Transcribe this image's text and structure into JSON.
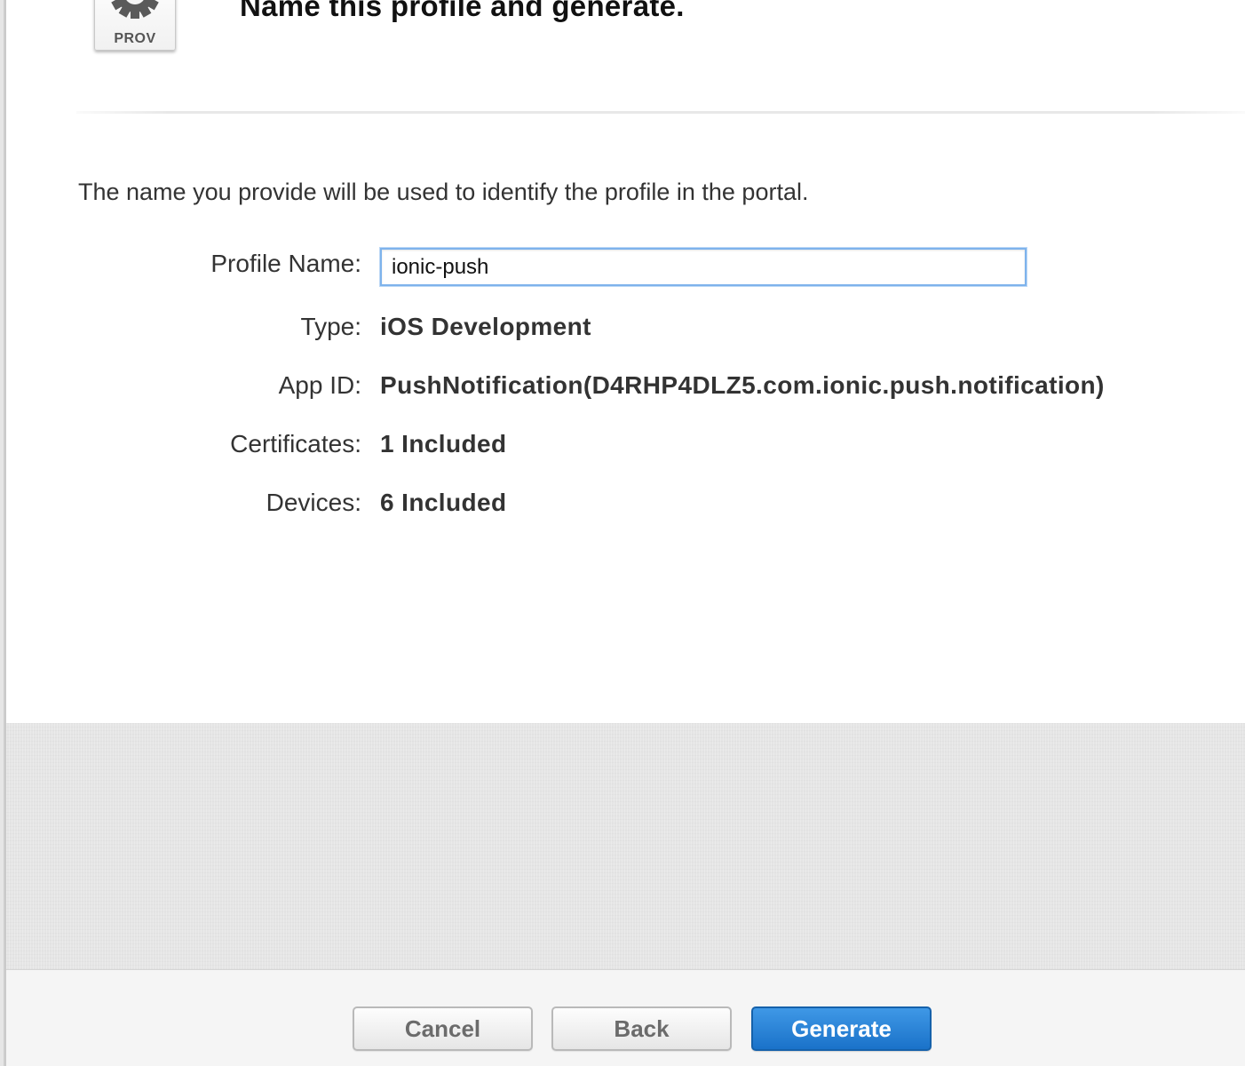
{
  "header": {
    "icon_name": "provisioning-profile-gear-icon",
    "icon_badge": "PROV",
    "title": "Name this profile and generate."
  },
  "main": {
    "description": "The name you provide will be used to identify the profile in the portal.",
    "profile_name": {
      "label": "Profile Name:",
      "value": "ionic-push",
      "focus_color": "#7eb3ec"
    },
    "type": {
      "label": "Type:",
      "value": "iOS Development"
    },
    "app_id": {
      "label": "App ID:",
      "value": "PushNotification(D4RHP4DLZ5.com.ionic.push.notification)"
    },
    "certificates": {
      "label": "Certificates:",
      "value": "1 Included"
    },
    "devices": {
      "label": "Devices:",
      "value": "6 Included"
    }
  },
  "footer": {
    "cancel_label": "Cancel",
    "back_label": "Back",
    "generate_label": "Generate",
    "primary_color": "#2a84d8"
  }
}
